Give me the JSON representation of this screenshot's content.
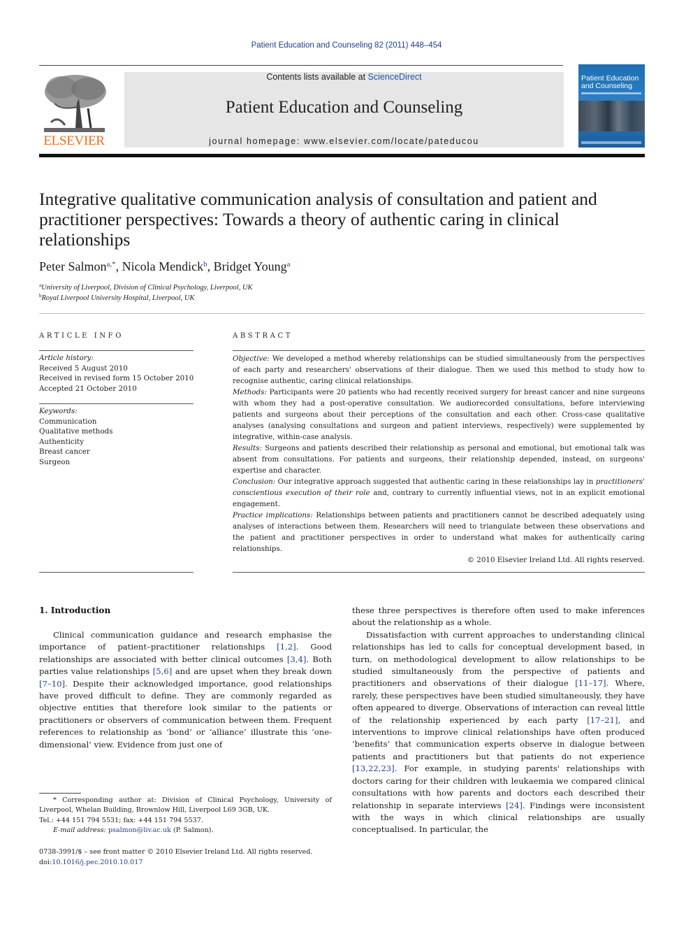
{
  "running_head": "Patient Education and Counseling 82 (2011) 448–454",
  "masthead": {
    "contents_prefix": "Contents lists available at ",
    "contents_link": "ScienceDirect",
    "journal_title": "Patient Education and Counseling",
    "homepage_label": "journal homepage: ",
    "homepage_url": "www.elsevier.com/locate/pateducou",
    "publisher_logo_text": "ELSEVIER",
    "cover_title": "Patient Education and Counseling"
  },
  "article": {
    "title": "Integrative qualitative communication analysis of consultation and patient and practitioner perspectives: Towards a theory of authentic caring in clinical relationships",
    "authors": [
      {
        "name": "Peter Salmon",
        "sup": "a,*"
      },
      {
        "name": "Nicola Mendick",
        "sup": "b"
      },
      {
        "name": "Bridget Young",
        "sup": "a"
      }
    ],
    "affiliations": [
      {
        "mark": "a",
        "text": "University of Liverpool, Division of Clinical Psychology, Liverpool, UK"
      },
      {
        "mark": "b",
        "text": "Royal Liverpool University Hospital, Liverpool, UK"
      }
    ]
  },
  "article_info": {
    "heading": "ARTICLE INFO",
    "history_label": "Article history:",
    "history": [
      "Received 5 August 2010",
      "Received in revised form 15 October 2010",
      "Accepted 21 October 2010"
    ],
    "keywords_label": "Keywords:",
    "keywords": [
      "Communication",
      "Qualitative methods",
      "Authenticity",
      "Breast cancer",
      "Surgeon"
    ]
  },
  "abstract": {
    "heading": "ABSTRACT",
    "objective_label": "Objective:",
    "objective": " We developed a method whereby relationships can be studied simultaneously from the perspectives of each party and researchers' observations of their dialogue. Then we used this method to study how to recognise authentic, caring clinical relationships.",
    "methods_label": "Methods:",
    "methods": " Participants were 20 patients who had recently received surgery for breast cancer and nine surgeons with whom they had a post-operative consultation. We audiorecorded consultations, before interviewing patients and surgeons about their perceptions of the consultation and each other. Cross-case qualitative analyses (analysing consultations and surgeon and patient interviews, respectively) were supplemented by integrative, within-case analysis.",
    "results_label": "Results:",
    "results": " Surgeons and patients described their relationship as personal and emotional, but emotional talk was absent from consultations. For patients and surgeons, their relationship depended, instead, on surgeons' expertise and character.",
    "conclusion_label": "Conclusion:",
    "conclusion_pre": " Our integrative approach suggested that authentic caring in these relationships lay in ",
    "conclusion_em": "practitioners' conscientious execution of their role",
    "conclusion_post": " and, contrary to currently influential views, not in an explicit emotional engagement.",
    "practice_label": "Practice implications:",
    "practice": "  Relationships between patients and practitioners cannot be described adequately using analyses of interactions between them. Researchers will need to triangulate between these observations and the patient and practitioner perspectives in order to understand what makes for authentically caring relationships.",
    "copyright": "© 2010 Elsevier Ireland Ltd. All rights reserved."
  },
  "introduction": {
    "heading": "1.  Introduction",
    "left_p1": [
      {
        "t": "Clinical communication guidance and research emphasise the importance of patient–practitioner relationships "
      },
      {
        "ref": "[1,2]"
      },
      {
        "t": ". Good relationships are associated with better clinical outcomes "
      },
      {
        "ref": "[3,4]"
      },
      {
        "t": ". Both parties value relationships "
      },
      {
        "ref": "[5,6]"
      },
      {
        "t": " and are upset when they break down "
      },
      {
        "ref": "[7–10]"
      },
      {
        "t": ". Despite their acknowledged importance, good relationships have proved difficult to define. They are commonly regarded as objective entities that therefore look similar to the patients or practitioners or observers of communication between them. Frequent references to relationship as ‘bond’ or ‘alliance’ illustrate this ‘one-dimensional’ view. Evidence from just one of"
      }
    ],
    "right_p1": "these three perspectives is therefore often used to make inferences about the relationship as a whole.",
    "right_p2": [
      {
        "t": "Dissatisfaction with current approaches to understanding clinical relationships has led to calls for conceptual development based, in turn, on methodological development to allow relationships to be studied simultaneously from the perspective of patients and practitioners and observations of their dialogue "
      },
      {
        "ref": "[11–17]"
      },
      {
        "t": ". Where, rarely, these perspectives have been studied simultaneously, they have often appeared to diverge. Observations of interaction can reveal little of the relationship experienced by each party "
      },
      {
        "ref": "[17–21]"
      },
      {
        "t": ", and interventions to improve clinical relationships have often produced ‘benefits’ that communication experts observe in dialogue between patients and practitioners but that patients do not experience "
      },
      {
        "ref": "[13,22,23]"
      },
      {
        "t": ". For example, in studying parents' relationships with doctors caring for their children with leukaemia we compared clinical consultations with how parents and doctors each described their relationship in separate interviews "
      },
      {
        "ref": "[24]"
      },
      {
        "t": ". Findings were inconsistent with the ways in which clinical relationships are usually conceptualised. In particular, the"
      }
    ]
  },
  "footnote": {
    "corresponding": "* Corresponding author at: Division of Clinical Psychology, University of Liverpool, Whelan Building, Brownlow Hill, Liverpool L69 3GB, UK.",
    "tel": "Tel.: +44 151 794 5531; fax: +44 151 794 5537.",
    "email_label": "E-mail address: ",
    "email": "psalmon@liv.ac.uk",
    "email_suffix": " (P. Salmon)."
  },
  "front_matter": {
    "issn_line": "0738-3991/$ – see front matter © 2010 Elsevier Ireland Ltd. All rights reserved.",
    "doi_label": "doi:",
    "doi": "10.1016/j.pec.2010.10.017"
  },
  "colors": {
    "link": "#1b3f8b",
    "elsevier_orange": "#e86e1a",
    "masthead_gray": "#e6e6e6",
    "cover_blue": "#2b80c4"
  }
}
